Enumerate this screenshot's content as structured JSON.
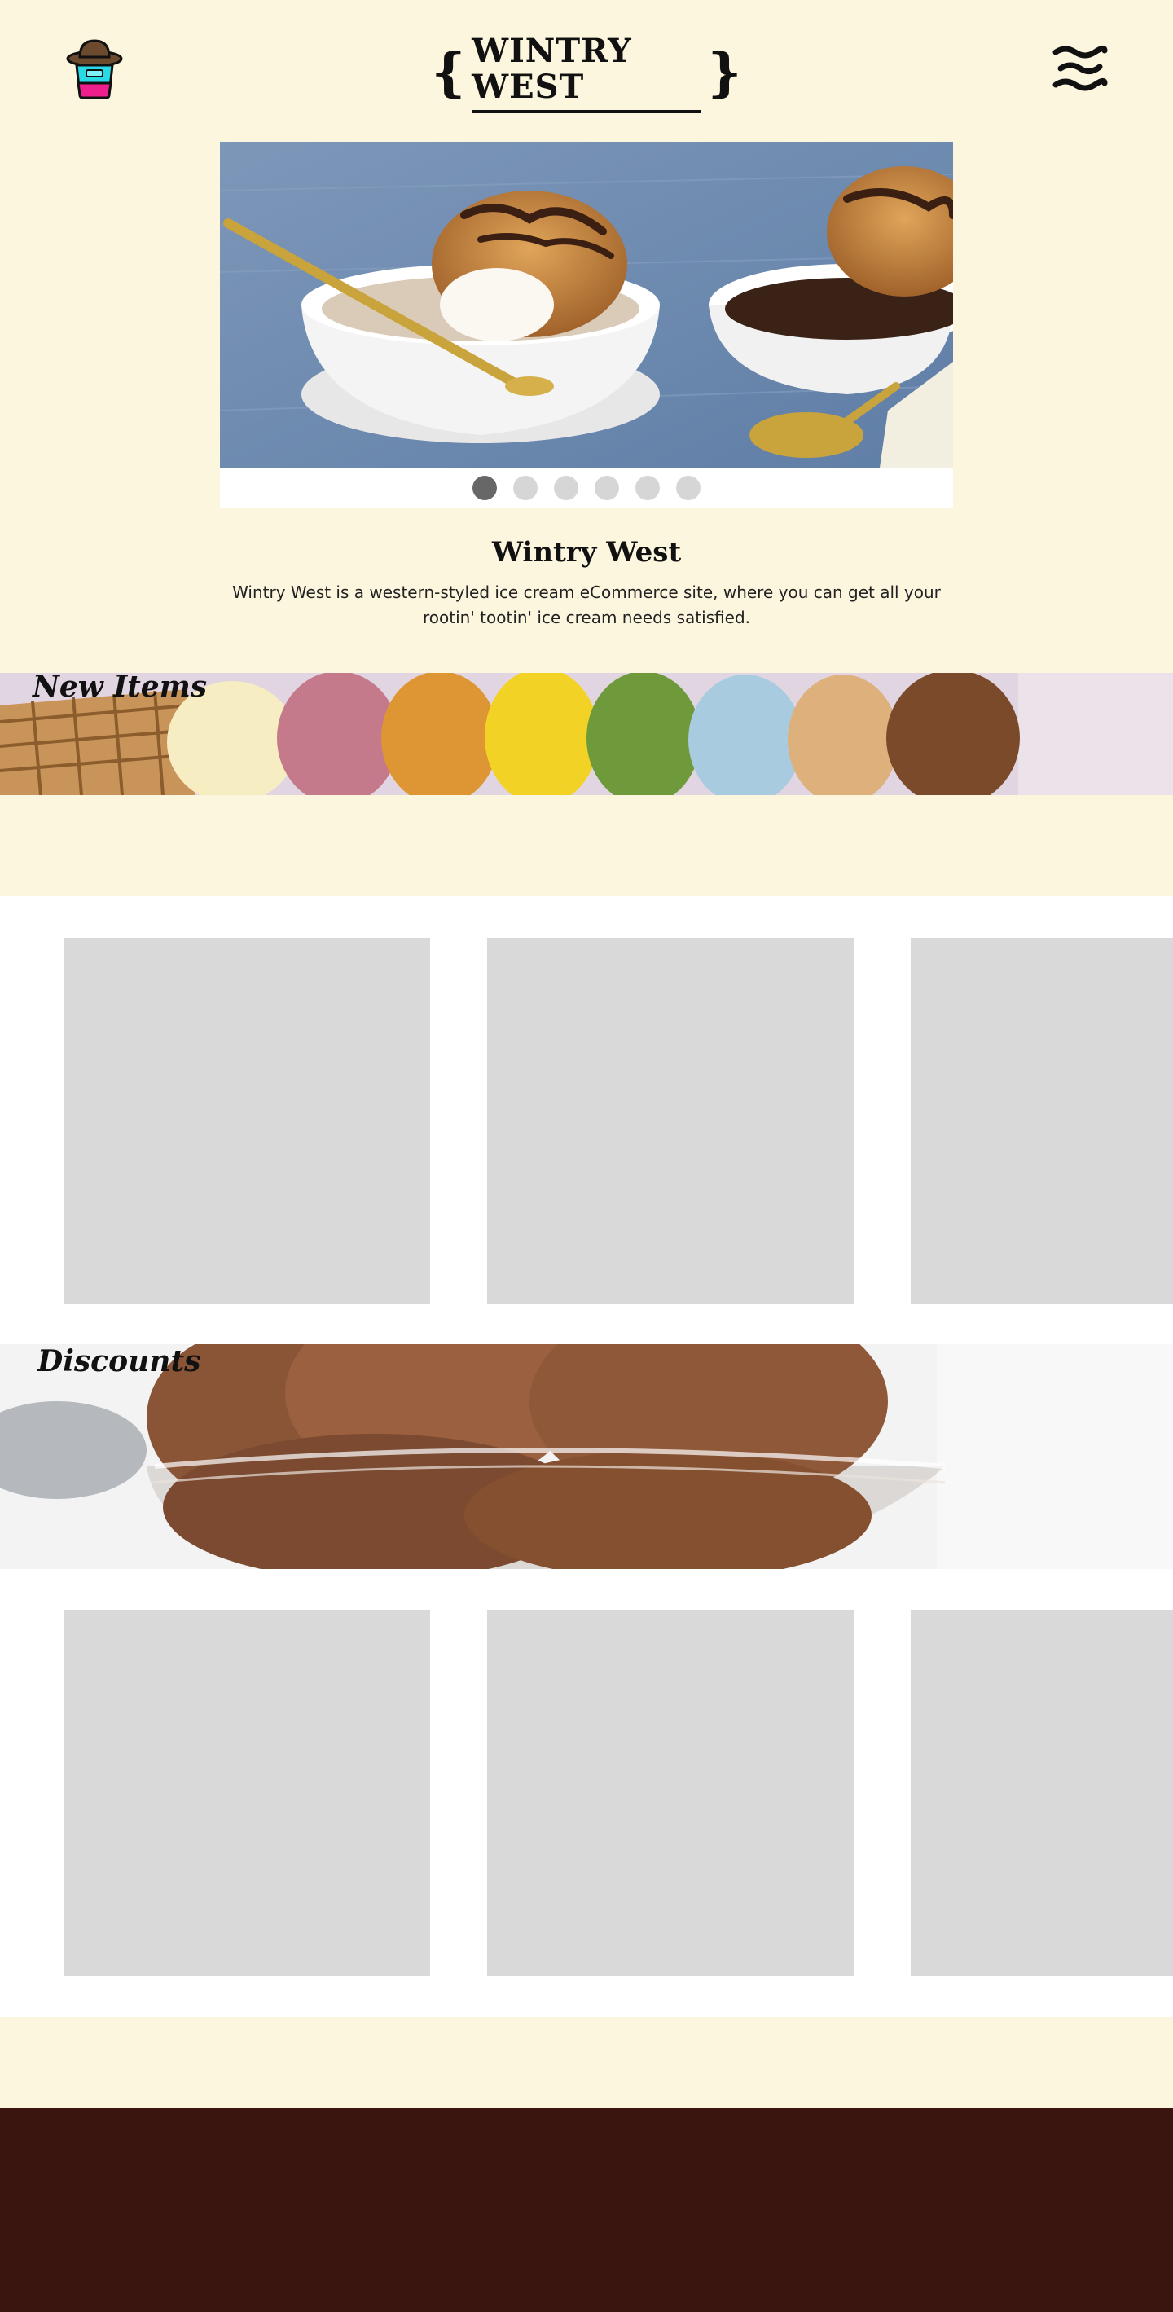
{
  "header": {
    "brand": "WINTRY WEST",
    "brace_left": "{",
    "brace_right": "}"
  },
  "icons": {
    "logo": "cowboy-ice-cream-cup-icon",
    "menu": "wavy-hamburger-menu-icon"
  },
  "hero": {
    "slides": 6,
    "active_slide": 1
  },
  "intro": {
    "title": "Wintry West",
    "description": "Wintry West is a western-styled ice cream eCommerce site, where you can get all your rootin' tootin' ice cream needs satisfied."
  },
  "sections": {
    "new_items": {
      "title": "New Items",
      "product_count": 3
    },
    "discounts": {
      "title": "Discounts",
      "product_count": 3
    }
  },
  "colors": {
    "page_background": "#fdf6df",
    "footer_background": "#3a150f",
    "placeholder": "#d9d9d9",
    "dot_active": "#676767",
    "dot_inactive": "#d6d6d6"
  }
}
